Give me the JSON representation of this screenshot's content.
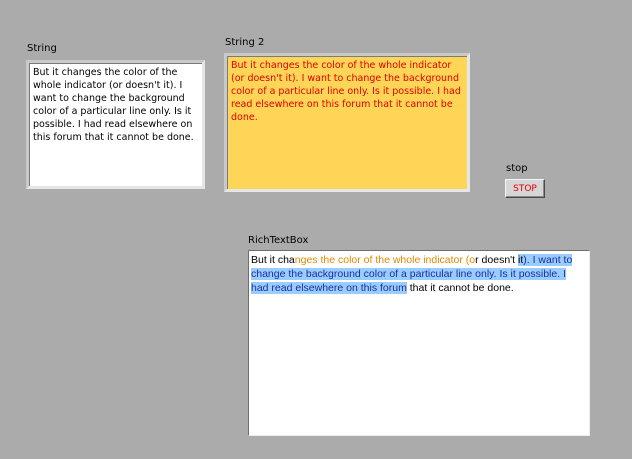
{
  "string1": {
    "label": "String",
    "text": "But it changes the color of the whole indicator (or doesn't it). I want to change the background color of a particular line only. Is it possible. I had read elsewhere on this forum that it cannot be done."
  },
  "string2": {
    "label": "String 2",
    "text": "But it changes the color of the whole indicator (or doesn't it). I want to change the background color of a particular line only. Is it possible. I had read elsewhere on this forum that it cannot be done.",
    "text_color": "#e00000",
    "background_color": "#ffd557"
  },
  "stop": {
    "label": "stop",
    "button_text": "STOP",
    "text_color": "#e00000"
  },
  "richtextbox": {
    "label": "RichTextBox",
    "segments": {
      "s1": "But it cha",
      "s2": "nges the color of the whole indicator (o",
      "s3": "r doesn't ",
      "s4": "it",
      "s5": "). I want to change the background color of a particular line only. Is it possible. I had read elsewhere on this forum",
      "s6": " that it cannot be done."
    },
    "orange_color": "#e08a00",
    "highlight_color": "#99ccff"
  }
}
